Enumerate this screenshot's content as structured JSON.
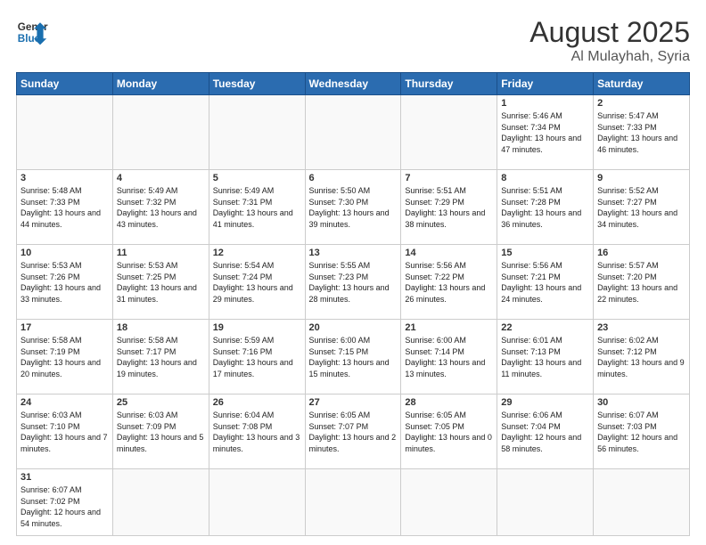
{
  "header": {
    "logo_general": "General",
    "logo_blue": "Blue",
    "month_year": "August 2025",
    "location": "Al Mulayhah, Syria"
  },
  "weekdays": [
    "Sunday",
    "Monday",
    "Tuesday",
    "Wednesday",
    "Thursday",
    "Friday",
    "Saturday"
  ],
  "rows": [
    [
      {
        "day": "",
        "info": ""
      },
      {
        "day": "",
        "info": ""
      },
      {
        "day": "",
        "info": ""
      },
      {
        "day": "",
        "info": ""
      },
      {
        "day": "",
        "info": ""
      },
      {
        "day": "1",
        "info": "Sunrise: 5:46 AM\nSunset: 7:34 PM\nDaylight: 13 hours and 47 minutes."
      },
      {
        "day": "2",
        "info": "Sunrise: 5:47 AM\nSunset: 7:33 PM\nDaylight: 13 hours and 46 minutes."
      }
    ],
    [
      {
        "day": "3",
        "info": "Sunrise: 5:48 AM\nSunset: 7:33 PM\nDaylight: 13 hours and 44 minutes."
      },
      {
        "day": "4",
        "info": "Sunrise: 5:49 AM\nSunset: 7:32 PM\nDaylight: 13 hours and 43 minutes."
      },
      {
        "day": "5",
        "info": "Sunrise: 5:49 AM\nSunset: 7:31 PM\nDaylight: 13 hours and 41 minutes."
      },
      {
        "day": "6",
        "info": "Sunrise: 5:50 AM\nSunset: 7:30 PM\nDaylight: 13 hours and 39 minutes."
      },
      {
        "day": "7",
        "info": "Sunrise: 5:51 AM\nSunset: 7:29 PM\nDaylight: 13 hours and 38 minutes."
      },
      {
        "day": "8",
        "info": "Sunrise: 5:51 AM\nSunset: 7:28 PM\nDaylight: 13 hours and 36 minutes."
      },
      {
        "day": "9",
        "info": "Sunrise: 5:52 AM\nSunset: 7:27 PM\nDaylight: 13 hours and 34 minutes."
      }
    ],
    [
      {
        "day": "10",
        "info": "Sunrise: 5:53 AM\nSunset: 7:26 PM\nDaylight: 13 hours and 33 minutes."
      },
      {
        "day": "11",
        "info": "Sunrise: 5:53 AM\nSunset: 7:25 PM\nDaylight: 13 hours and 31 minutes."
      },
      {
        "day": "12",
        "info": "Sunrise: 5:54 AM\nSunset: 7:24 PM\nDaylight: 13 hours and 29 minutes."
      },
      {
        "day": "13",
        "info": "Sunrise: 5:55 AM\nSunset: 7:23 PM\nDaylight: 13 hours and 28 minutes."
      },
      {
        "day": "14",
        "info": "Sunrise: 5:56 AM\nSunset: 7:22 PM\nDaylight: 13 hours and 26 minutes."
      },
      {
        "day": "15",
        "info": "Sunrise: 5:56 AM\nSunset: 7:21 PM\nDaylight: 13 hours and 24 minutes."
      },
      {
        "day": "16",
        "info": "Sunrise: 5:57 AM\nSunset: 7:20 PM\nDaylight: 13 hours and 22 minutes."
      }
    ],
    [
      {
        "day": "17",
        "info": "Sunrise: 5:58 AM\nSunset: 7:19 PM\nDaylight: 13 hours and 20 minutes."
      },
      {
        "day": "18",
        "info": "Sunrise: 5:58 AM\nSunset: 7:17 PM\nDaylight: 13 hours and 19 minutes."
      },
      {
        "day": "19",
        "info": "Sunrise: 5:59 AM\nSunset: 7:16 PM\nDaylight: 13 hours and 17 minutes."
      },
      {
        "day": "20",
        "info": "Sunrise: 6:00 AM\nSunset: 7:15 PM\nDaylight: 13 hours and 15 minutes."
      },
      {
        "day": "21",
        "info": "Sunrise: 6:00 AM\nSunset: 7:14 PM\nDaylight: 13 hours and 13 minutes."
      },
      {
        "day": "22",
        "info": "Sunrise: 6:01 AM\nSunset: 7:13 PM\nDaylight: 13 hours and 11 minutes."
      },
      {
        "day": "23",
        "info": "Sunrise: 6:02 AM\nSunset: 7:12 PM\nDaylight: 13 hours and 9 minutes."
      }
    ],
    [
      {
        "day": "24",
        "info": "Sunrise: 6:03 AM\nSunset: 7:10 PM\nDaylight: 13 hours and 7 minutes."
      },
      {
        "day": "25",
        "info": "Sunrise: 6:03 AM\nSunset: 7:09 PM\nDaylight: 13 hours and 5 minutes."
      },
      {
        "day": "26",
        "info": "Sunrise: 6:04 AM\nSunset: 7:08 PM\nDaylight: 13 hours and 3 minutes."
      },
      {
        "day": "27",
        "info": "Sunrise: 6:05 AM\nSunset: 7:07 PM\nDaylight: 13 hours and 2 minutes."
      },
      {
        "day": "28",
        "info": "Sunrise: 6:05 AM\nSunset: 7:05 PM\nDaylight: 13 hours and 0 minutes."
      },
      {
        "day": "29",
        "info": "Sunrise: 6:06 AM\nSunset: 7:04 PM\nDaylight: 12 hours and 58 minutes."
      },
      {
        "day": "30",
        "info": "Sunrise: 6:07 AM\nSunset: 7:03 PM\nDaylight: 12 hours and 56 minutes."
      }
    ],
    [
      {
        "day": "31",
        "info": "Sunrise: 6:07 AM\nSunset: 7:02 PM\nDaylight: 12 hours and 54 minutes."
      },
      {
        "day": "",
        "info": ""
      },
      {
        "day": "",
        "info": ""
      },
      {
        "day": "",
        "info": ""
      },
      {
        "day": "",
        "info": ""
      },
      {
        "day": "",
        "info": ""
      },
      {
        "day": "",
        "info": ""
      }
    ]
  ]
}
